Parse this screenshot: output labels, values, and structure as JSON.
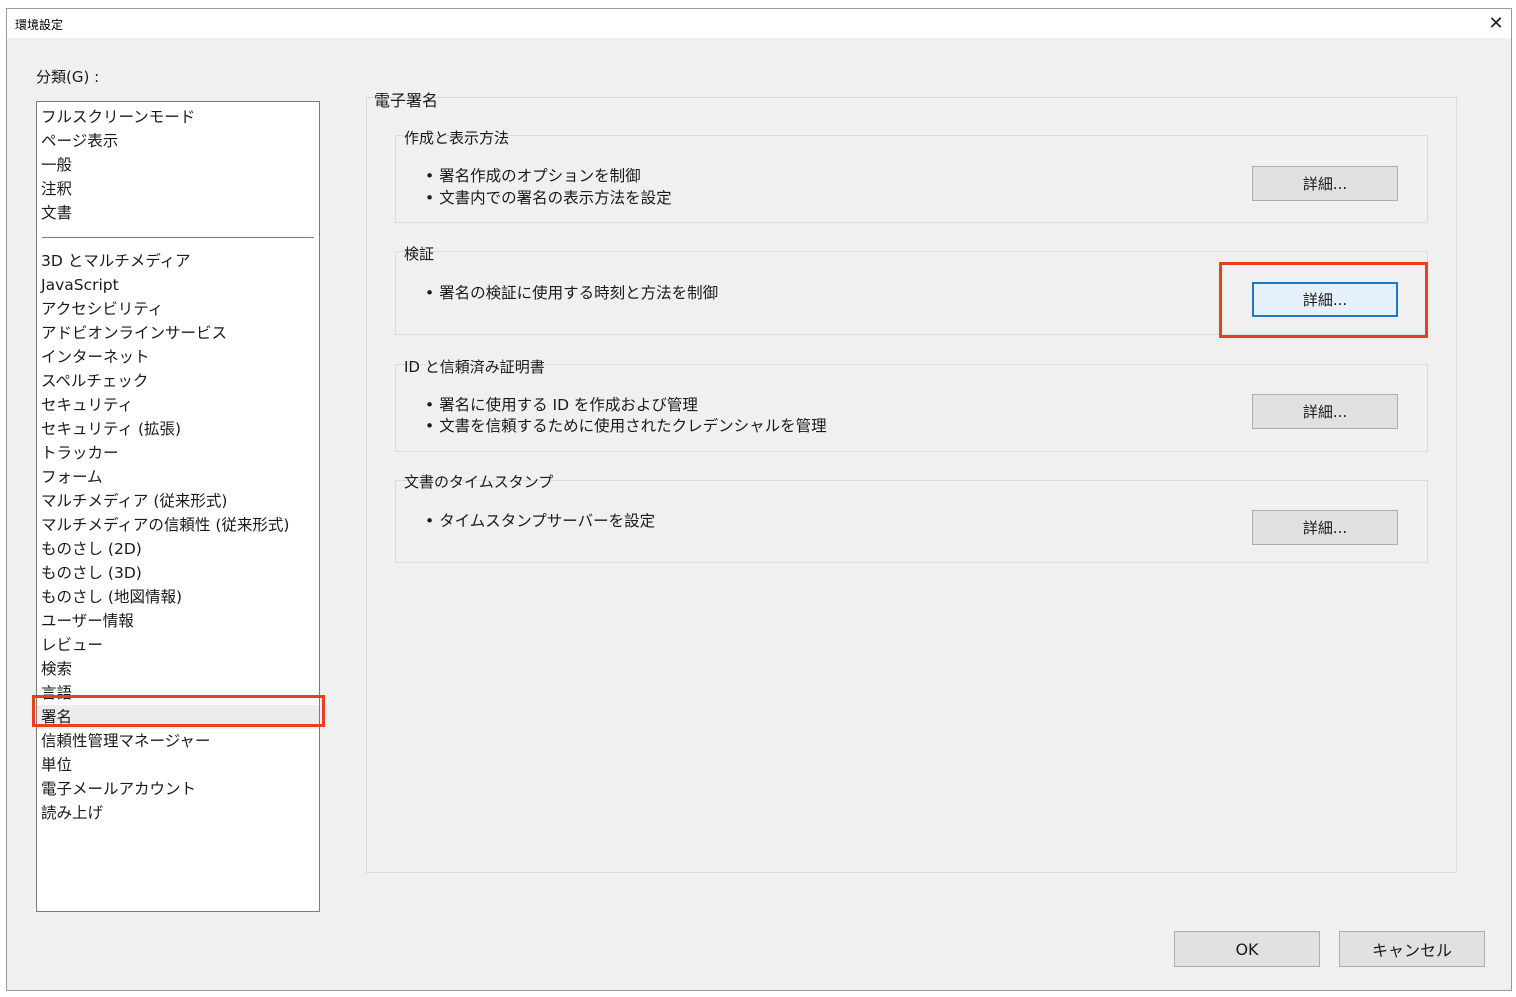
{
  "window": {
    "title": "環境設定",
    "close_glyph": "✕"
  },
  "category": {
    "label": "分類(G) :",
    "group1": [
      "フルスクリーンモード",
      "ページ表示",
      "一般",
      "注釈",
      "文書"
    ],
    "group2": [
      "3D とマルチメディア",
      "JavaScript",
      "アクセシビリティ",
      "アドビオンラインサービス",
      "インターネット",
      "スペルチェック",
      "セキュリティ",
      "セキュリティ (拡張)",
      "トラッカー",
      "フォーム",
      "マルチメディア (従来形式)",
      "マルチメディアの信頼性 (従来形式)",
      "ものさし (2D)",
      "ものさし (3D)",
      "ものさし (地図情報)",
      "ユーザー情報",
      "レビュー",
      "検索",
      "言語",
      "署名",
      "信頼性管理マネージャー",
      "単位",
      "電子メールアカウント",
      "読み上げ"
    ],
    "selected": "署名"
  },
  "main": {
    "title": "電子署名",
    "groups": [
      {
        "title": "作成と表示方法",
        "lines": [
          "• 署名作成のオプションを制御",
          "• 文書内での署名の表示方法を設定"
        ],
        "button": "詳細..."
      },
      {
        "title": "検証",
        "lines": [
          "• 署名の検証に使用する時刻と方法を制御"
        ],
        "button": "詳細..."
      },
      {
        "title": "ID と信頼済み証明書",
        "lines": [
          "• 署名に使用する ID を作成および管理",
          "• 文書を信頼するために使用されたクレデンシャルを管理"
        ],
        "button": "詳細..."
      },
      {
        "title": "文書のタイムスタンプ",
        "lines": [
          "• タイムスタンプサーバーを設定"
        ],
        "button": "詳細..."
      }
    ]
  },
  "footer": {
    "ok": "OK",
    "cancel": "キャンセル"
  },
  "colors": {
    "highlight": "#e8401e",
    "focus": "#1b78c8"
  }
}
